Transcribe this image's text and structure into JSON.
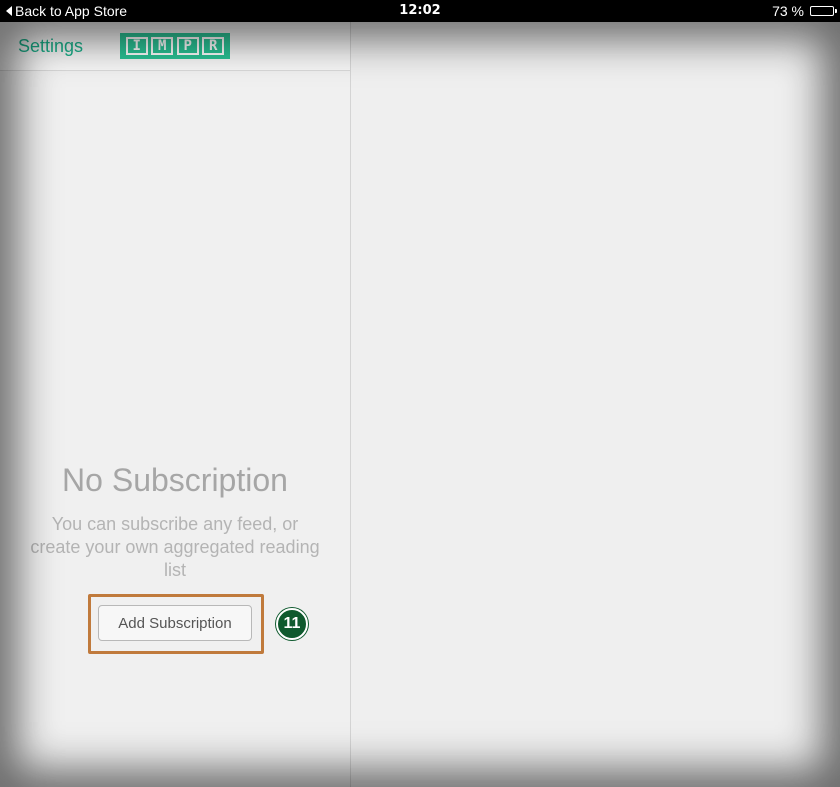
{
  "status_bar": {
    "back_label": "Back to App Store",
    "time": "12:02",
    "battery_label": "73 %",
    "battery_level": 0.73
  },
  "navbar": {
    "settings_label": "Settings",
    "logo_letters": [
      "I",
      "M",
      "P",
      "R"
    ],
    "accent_color": "#1ab08a"
  },
  "empty_state": {
    "title": "No Subscription",
    "message": "You can subscribe any feed, or create your own aggregated reading list",
    "button_label": "Add Subscription"
  },
  "annotation": {
    "step_number": "11",
    "highlight_color": "#c07a3c",
    "badge_color": "#0f5a2e"
  }
}
